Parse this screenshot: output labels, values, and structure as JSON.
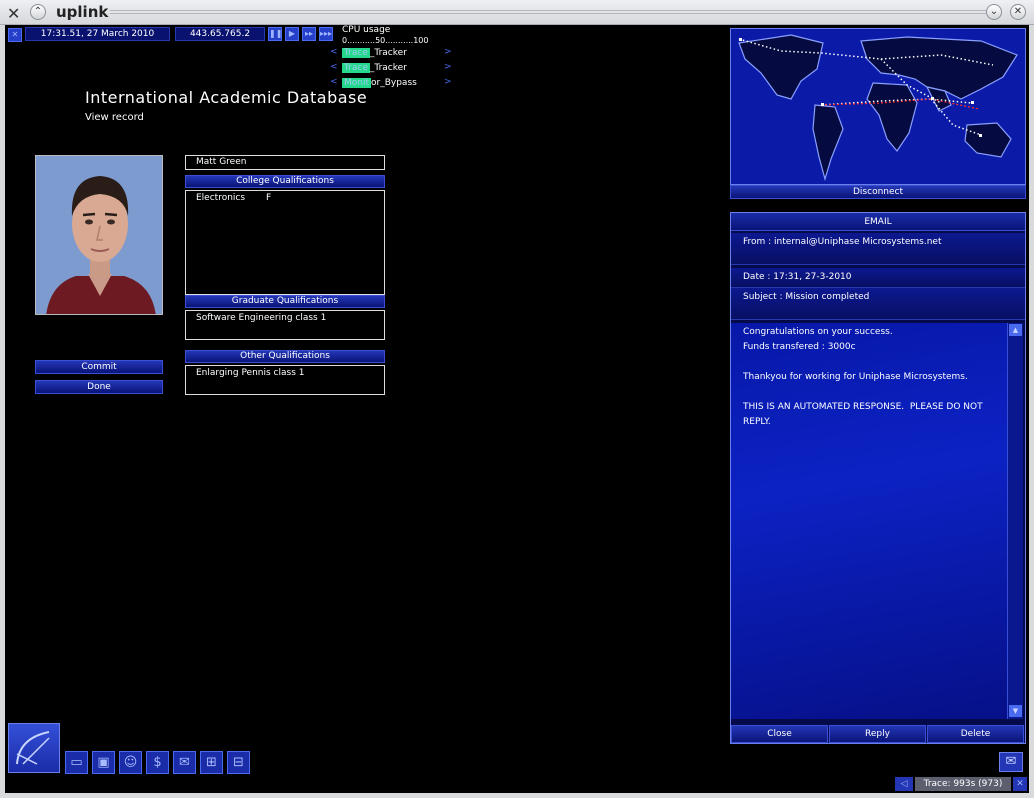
{
  "window": {
    "title": "uplink"
  },
  "hud": {
    "datetime": "17:31.51, 27 March 2010",
    "ip": "443.65.765.2",
    "speed_buttons": [
      "pause",
      "play",
      "fast",
      "fastest"
    ],
    "cpu_label": "CPU usage",
    "cpu_scale": "0...........50...........100",
    "cpu_rows": [
      {
        "hl": "Trace",
        "rest": "_Tracker"
      },
      {
        "hl": "Trace",
        "rest": "_Tracker"
      },
      {
        "hl": "Monit",
        "rest": "or_Bypass"
      }
    ]
  },
  "record": {
    "heading": "International Academic Database",
    "subheading": "View record",
    "name": "Matt Green",
    "college_header": "College Qualifications",
    "college_subject": "Electronics",
    "college_grade": "F",
    "graduate_header": "Graduate Qualifications",
    "graduate_value": "Software Engineering class 1",
    "other_header": "Other Qualifications",
    "other_value": "Enlarging Pennis class 1",
    "commit_label": "Commit",
    "done_label": "Done"
  },
  "map": {
    "disconnect_label": "Disconnect"
  },
  "email": {
    "title": "EMAIL",
    "from": "From : internal@Uniphase Microsystems.net",
    "date": "Date : 17:31, 27-3-2010",
    "subject": "Subject : Mission completed",
    "body": "Congratulations on your success.\nFunds transfered : 3000c\n\nThankyou for working for Uniphase Microsystems.\n\nTHIS IS AN AUTOMATED RESPONSE.  PLEASE DO NOT REPLY.",
    "close_label": "Close",
    "reply_label": "Reply",
    "delete_label": "Delete"
  },
  "status": {
    "trace": "Trace: 993s (973)"
  },
  "colors": {
    "accent": "#0a1478",
    "highlight": "#25d98c",
    "panel": "#040a4a"
  }
}
